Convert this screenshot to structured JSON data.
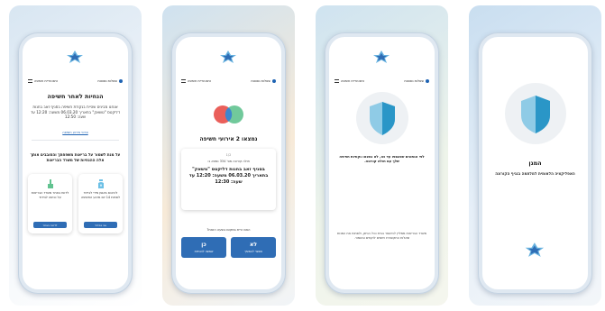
{
  "app": {
    "ministry_logo_line1": "משרד",
    "ministry_logo_line2": "הבריאות"
  },
  "topbar": {
    "right_label": "שאלות נפוצות",
    "left_label": "היסטוריית חשיפה"
  },
  "screen1": {
    "title": "הנחיות לאחר חשיפה",
    "body": "אנחנו מבינים שהיית בנקודת חשיפה בסניף זאב בחנות דליקטס \"טשאק\" בתאריך 06.03.20 משעה: 12:20 עד שעה: 12:50",
    "link": "פרטי אירוע חשיפה",
    "subtitle": "על מנת לשמור על בריאות משפחתך והסובבים אותך אלה ההנחיות של משרד הבריאות",
    "card_right": {
      "text": "להיכנס באופן מידי לבידוד לפחות 14 יום מרגע החשיפה",
      "button": "אני בבידוד"
    },
    "card_left": {
      "text": "לדווח באתר משרד הבריאות על כניסה לבידוד",
      "button": "לדיווח באתר"
    }
  },
  "screen2": {
    "title": "נמצאו 2 אירועי חשיפה",
    "pager": "1/2",
    "patient": "חולה קורונה מס' 334 נמצא ב:",
    "detail": "בסניף זאב בחנות דליקטס \"טשאק\" בתאריך 06.03.20 משעה: 12:20 עד שעה: 12:30",
    "question": "האם היית במקום בשעה הזאת?",
    "yes_big": "כן",
    "yes_small": "שמשה להנחיות",
    "no_big": "לא",
    "no_small": "אפשר להמשיך"
  },
  "screen3": {
    "text": "לפי הנתונים שנאספו עד כה, לא נמצאו נקודות חפיפה שלך עם חולה קורונה.",
    "footer": "משרד הבריאות ממליץ להישאר בבית ככל הניתן, ולפתוח את המנות שאלות התקשורת ויחסים לוקחים ובשמור."
  },
  "screen4": {
    "title": "המגן",
    "subtitle": "האפליקציה הלאומית למלחמה בנגיף הקורונה"
  },
  "colors": {
    "primary_blue": "#2f6db5",
    "shield_light": "#8fcbe6",
    "shield_dark": "#2a96c7",
    "circle_orange": "#f2a341",
    "circle_red": "#ea5f5a",
    "circle_green": "#62c390",
    "circle_blue": "#3d86cf"
  }
}
